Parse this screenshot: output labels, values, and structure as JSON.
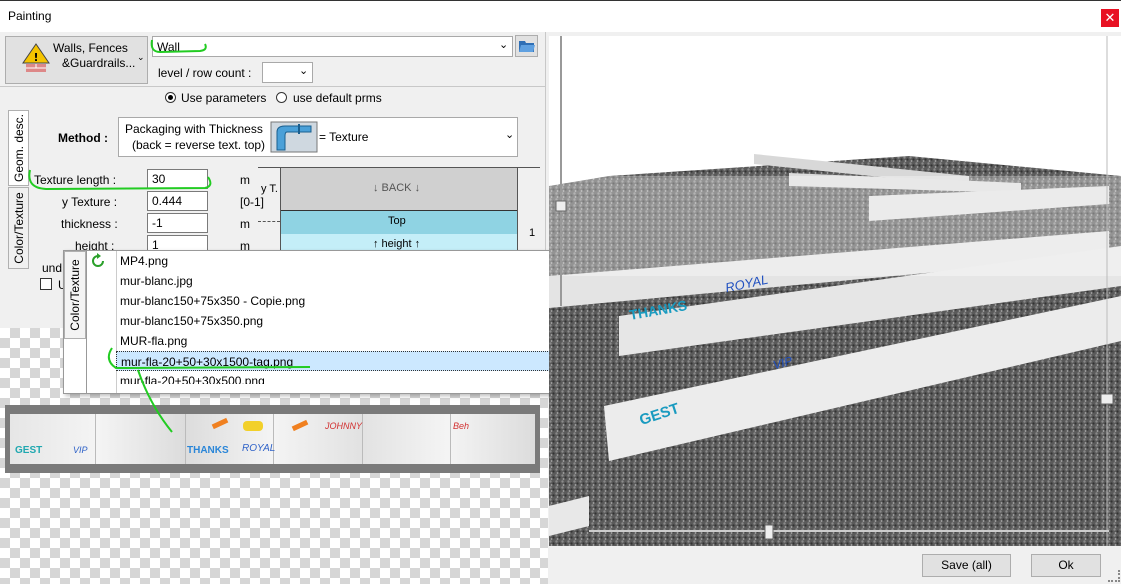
{
  "window": {
    "title": "Painting",
    "close_glyph": "✕"
  },
  "category_button": {
    "line1": "Walls, Fences",
    "line2": "&Guardrails..."
  },
  "object_combo": {
    "value": "Wall"
  },
  "level_row": {
    "label": "level / row count :",
    "value": ""
  },
  "radio": {
    "use_parameters": "Use parameters",
    "use_default": "use default prms",
    "selected": "use_parameters"
  },
  "tabs": {
    "geom": "Geom. desc.",
    "color": "Color/Texture",
    "color_popup": "Color/Texture"
  },
  "method": {
    "label": "Method :",
    "line1": "Packaging with Thickness",
    "line2": "(back = reverse text. top)",
    "result": "= Texture"
  },
  "params": [
    {
      "label": "Texture length :",
      "value": "30",
      "unit": "m"
    },
    {
      "label": "y Texture :",
      "value": "0.444",
      "unit": "[0-1]"
    },
    {
      "label": "thickness :",
      "value": "-1",
      "unit": "m"
    },
    {
      "label": "height :",
      "value": "1",
      "unit": "m"
    }
  ],
  "diagram": {
    "back": "↓ BACK ↓",
    "top": "Top",
    "height": "↑ height ↑",
    "yt": "y T.",
    "one": "1"
  },
  "partial_labels": {
    "und": "und",
    "u": "U"
  },
  "file_list": {
    "items": [
      "MP4.png",
      "mur-blanc.jpg",
      "mur-blanc150+75x350 - Copie.png",
      "mur-blanc150+75x350.png",
      "MUR-fla.png",
      "mur-fla-20+50+30x1500-tag.png",
      "mur-fla-20+50+30x500.png"
    ],
    "selected_index": 5
  },
  "texture_strip": {
    "tags": [
      "GEST",
      "VIP",
      "THANKS",
      "ROYAL",
      "JOHNNY",
      "Beh"
    ]
  },
  "scene_tags": [
    "THANKS",
    "ROYAL",
    "VIP",
    "GEST"
  ],
  "buttons": {
    "save": "Save (all)",
    "ok": "Ok"
  },
  "colors": {
    "accent_selected": "#cce8ff",
    "top_cyan": "#8fd3e3",
    "annotation_green": "#22cc22",
    "close_red": "#e81123"
  }
}
